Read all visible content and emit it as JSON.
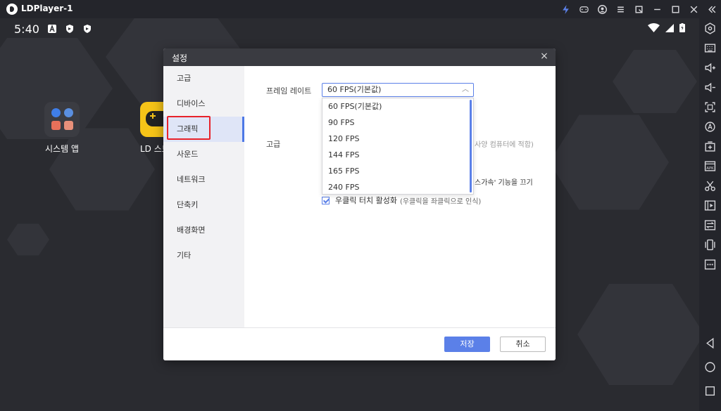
{
  "window": {
    "title": "LDPlayer-1"
  },
  "status_bar": {
    "time": "5:40"
  },
  "desktop": {
    "apps": [
      {
        "label": "시스템 앱"
      },
      {
        "label": "LD 스토"
      }
    ]
  },
  "dialog": {
    "title": "설정",
    "close": "×",
    "nav": [
      {
        "label": "고급"
      },
      {
        "label": "디바이스"
      },
      {
        "label": "그래픽"
      },
      {
        "label": "사운드"
      },
      {
        "label": "네트워크"
      },
      {
        "label": "단축키"
      },
      {
        "label": "배경화면"
      },
      {
        "label": "기타"
      }
    ],
    "active_nav": "그래픽",
    "content": {
      "frame_rate_label": "프레임 레이트",
      "frame_rate_value": "60 FPS(기본값)",
      "frame_rate_options": [
        "60 FPS(기본값)",
        "90 FPS",
        "120 FPS",
        "144 FPS",
        "165 FPS",
        "240 FPS"
      ],
      "advanced_label": "고급",
      "advanced_hint_partial": "사양 컴퓨터에 적합)",
      "accel_partial": "스가속' 기능을 끄기",
      "right_click_label": "우클릭 터치 활성화",
      "right_click_hint": "(우클릭을 좌클릭으로 인식)",
      "right_click_checked": true
    },
    "buttons": {
      "save": "저장",
      "cancel": "취소"
    }
  },
  "colors": {
    "accent": "#5b80e8",
    "highlight": "#e8222a"
  }
}
